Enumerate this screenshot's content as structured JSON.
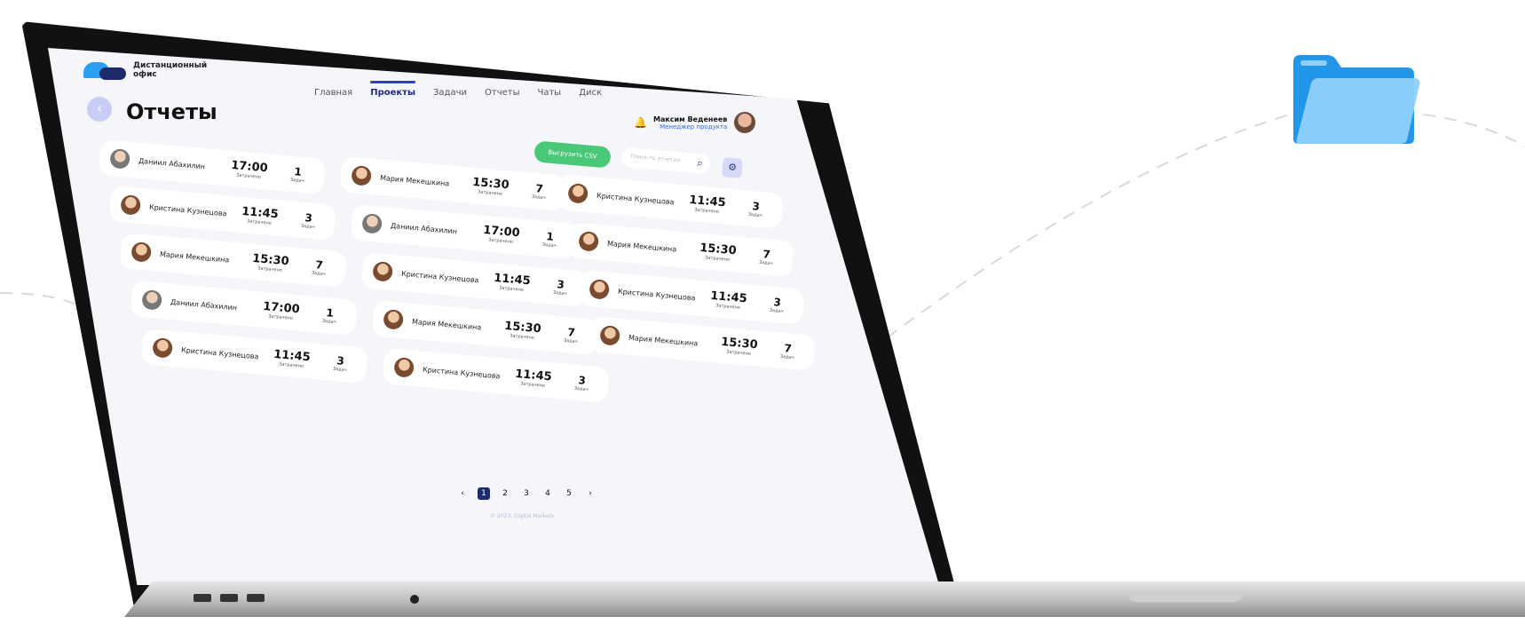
{
  "app": {
    "logo_line1": "Дистанционный",
    "logo_line2": "офис"
  },
  "nav": [
    {
      "label": "Главная",
      "active": false
    },
    {
      "label": "Проекты",
      "active": true
    },
    {
      "label": "Задачи",
      "active": false
    },
    {
      "label": "Отчеты",
      "active": false
    },
    {
      "label": "Чаты",
      "active": false
    },
    {
      "label": "Диск",
      "active": false
    }
  ],
  "page": {
    "title": "Отчеты",
    "back_icon": "chevron-left-icon"
  },
  "user": {
    "name": "Максим Веденеев",
    "role": "Менеджер продукта",
    "notification_icon": "bell-icon"
  },
  "toolbar": {
    "csv_label": "Выгрузить CSV",
    "search_placeholder": "Поиск по отчетам",
    "search_icon": "search-icon",
    "filter_icon": "sliders-icon",
    "csv_color": "#49c978"
  },
  "cards": [
    {
      "name": "Даниил Абахилин",
      "time": "17:00",
      "time_label": "Затрачено",
      "count": "1",
      "count_label": "Задач"
    },
    {
      "name": "Кристина Кузнецова",
      "time": "11:45",
      "time_label": "Затрачено",
      "count": "3",
      "count_label": "Задач"
    },
    {
      "name": "Мария Мекешкина",
      "time": "15:30",
      "time_label": "Затрачено",
      "count": "7",
      "count_label": "Задач"
    },
    {
      "name": "Даниил Абахилин",
      "time": "17:00",
      "time_label": "Затрачено",
      "count": "1",
      "count_label": "Задач"
    },
    {
      "name": "Кристина Кузнецова",
      "time": "11:45",
      "time_label": "Затрачено",
      "count": "3",
      "count_label": "Задач"
    },
    {
      "name": "Мария Мекешкина",
      "time": "15:30",
      "time_label": "Затрачено",
      "count": "7",
      "count_label": "Задач"
    },
    {
      "name": "Даниил Абахилин",
      "time": "17:00",
      "time_label": "Затрачено",
      "count": "1",
      "count_label": "Задач"
    },
    {
      "name": "Кристина Кузнецова",
      "time": "11:45",
      "time_label": "Затрачено",
      "count": "3",
      "count_label": "Задач"
    },
    {
      "name": "Мария Мекешкина",
      "time": "15:30",
      "time_label": "Затрачено",
      "count": "7",
      "count_label": "Задач"
    },
    {
      "name": "Кристина Кузнецова",
      "time": "11:45",
      "time_label": "Затрачено",
      "count": "3",
      "count_label": "Задач"
    },
    {
      "name": "Кристина Кузнецова",
      "time": "11:45",
      "time_label": "Затрачено",
      "count": "3",
      "count_label": "Задач"
    },
    {
      "name": "Мария Мекешкина",
      "time": "15:30",
      "time_label": "Затрачено",
      "count": "7",
      "count_label": "Задач"
    },
    {
      "name": "Кристина Кузнецова",
      "time": "11:45",
      "time_label": "Затрачено",
      "count": "3",
      "count_label": "Задач"
    },
    {
      "name": "Мария Мекешкина",
      "time": "15:30",
      "time_label": "Затрачено",
      "count": "7",
      "count_label": "Задач"
    }
  ],
  "pagination": {
    "prev": "‹",
    "next": "›",
    "pages": [
      "1",
      "2",
      "3",
      "4",
      "5"
    ],
    "current": "1"
  },
  "footer": {
    "copyright": "© 2023, Digital Markets"
  }
}
